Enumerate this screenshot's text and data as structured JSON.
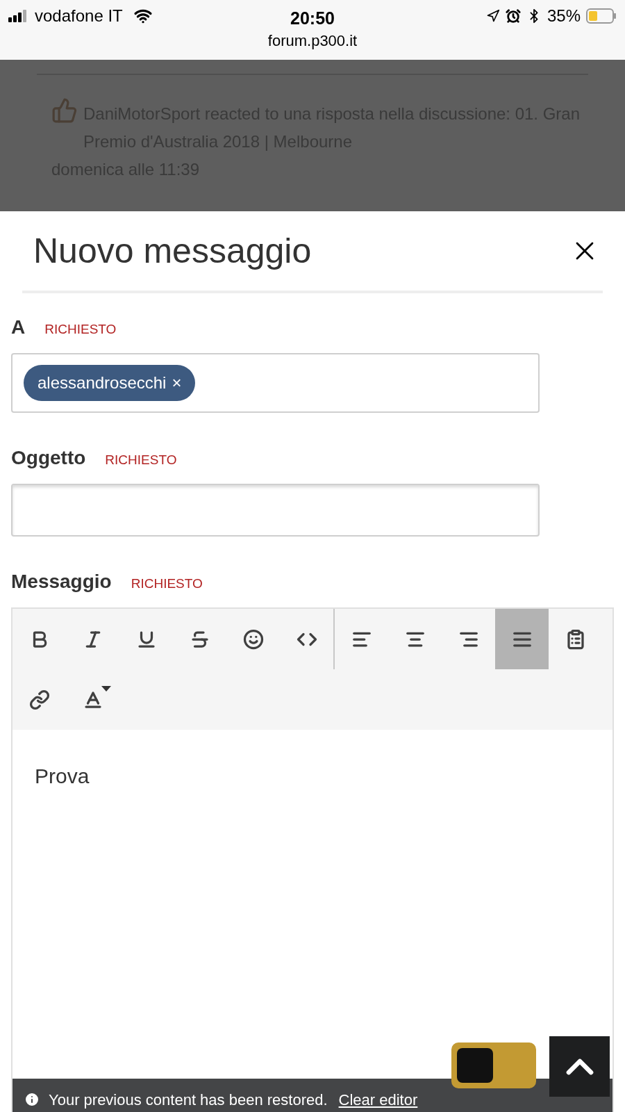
{
  "status_bar": {
    "carrier": "vodafone IT",
    "time": "20:50",
    "url": "forum.p300.it",
    "battery": "35%"
  },
  "background": {
    "notification": "DaniMotorSport reacted to una risposta nella discussione: 01. Gran Premio d'Australia 2018 | Melbourne",
    "time": "domenica alle 11:39"
  },
  "dialog": {
    "title": "Nuovo messaggio",
    "recipients": {
      "label": "A",
      "required": "RICHIESTO",
      "tokens": [
        {
          "text": "alessandrosecchi",
          "remove": "×"
        }
      ]
    },
    "subject": {
      "label": "Oggetto",
      "required": "RICHIESTO"
    },
    "message": {
      "label": "Messaggio",
      "required": "RICHIESTO",
      "body": "Prova",
      "toolbar": [
        [
          {
            "kind": "bold",
            "selected": false
          },
          {
            "kind": "italic",
            "selected": false
          },
          {
            "kind": "underline",
            "selected": false
          },
          {
            "kind": "strike",
            "selected": false
          },
          {
            "kind": "smile",
            "selected": false
          },
          {
            "kind": "code",
            "selected": false
          },
          {
            "kind": "align-left",
            "selected": false
          },
          {
            "kind": "align-center",
            "selected": false
          },
          {
            "kind": "align-right",
            "selected": false
          },
          {
            "kind": "justify",
            "selected": true
          },
          {
            "kind": "paste",
            "selected": false
          }
        ],
        [
          {
            "kind": "link",
            "selected": false
          },
          {
            "kind": "color",
            "selected": false
          }
        ]
      ]
    }
  },
  "toggle": {
    "on": false
  },
  "notice": {
    "text": "Your previous content has been restored.",
    "link": "Clear editor"
  }
}
